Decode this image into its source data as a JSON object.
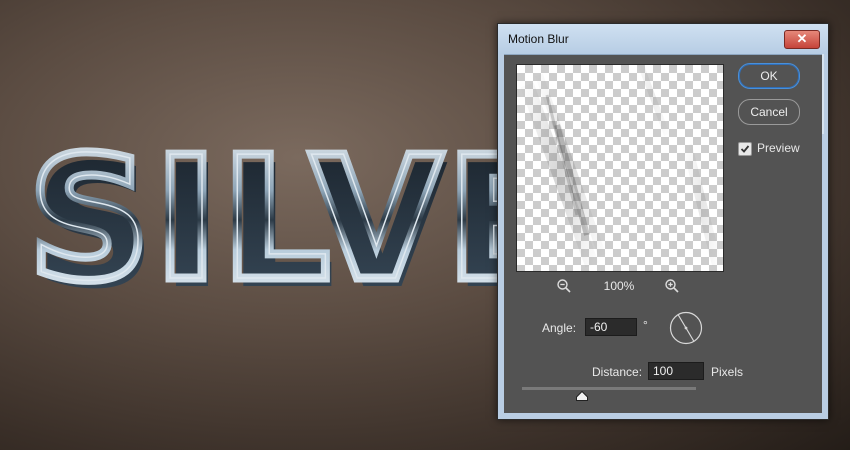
{
  "background": {
    "artwork_text": "SILVER"
  },
  "dialog": {
    "title": "Motion Blur",
    "close_label": "X",
    "ok_label": "OK",
    "cancel_label": "Cancel",
    "preview_label": "Preview",
    "preview_checked": true,
    "zoom_level": "100%",
    "angle_label": "Angle:",
    "angle_value": "-60",
    "degree_symbol": "°",
    "distance_label": "Distance:",
    "distance_value": "100",
    "distance_unit": "Pixels"
  },
  "colors": {
    "dialog_bg": "#535353",
    "titlebar": "#c3d6ea",
    "accent": "#4a90d9",
    "close": "#c5443a"
  }
}
